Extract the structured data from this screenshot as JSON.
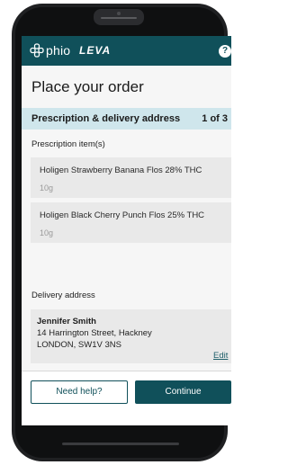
{
  "header": {
    "brand_phio": "phio",
    "brand_leva": "LEVA",
    "help_label": "?",
    "colors": {
      "header_bg": "#10505a",
      "accent": "#10505a",
      "step_bg": "#cfe6ec"
    }
  },
  "page": {
    "title": "Place your order"
  },
  "step": {
    "title": "Prescription & delivery address",
    "count": "1 of 3"
  },
  "prescription": {
    "label": "Prescription item(s)",
    "items": [
      {
        "name": "Holigen Strawberry Banana Flos 28% THC",
        "qty": "10g"
      },
      {
        "name": "Holigen Black Cherry Punch Flos 25% THC",
        "qty": "10g"
      }
    ]
  },
  "delivery": {
    "label": "Delivery address",
    "name": "Jennifer Smith",
    "line1": "14 Harrington Street, Hackney",
    "line2": "LONDON, SW1V 3NS",
    "edit_label": "Edit"
  },
  "actions": {
    "help_label": "Need help?",
    "continue_label": "Continue"
  }
}
